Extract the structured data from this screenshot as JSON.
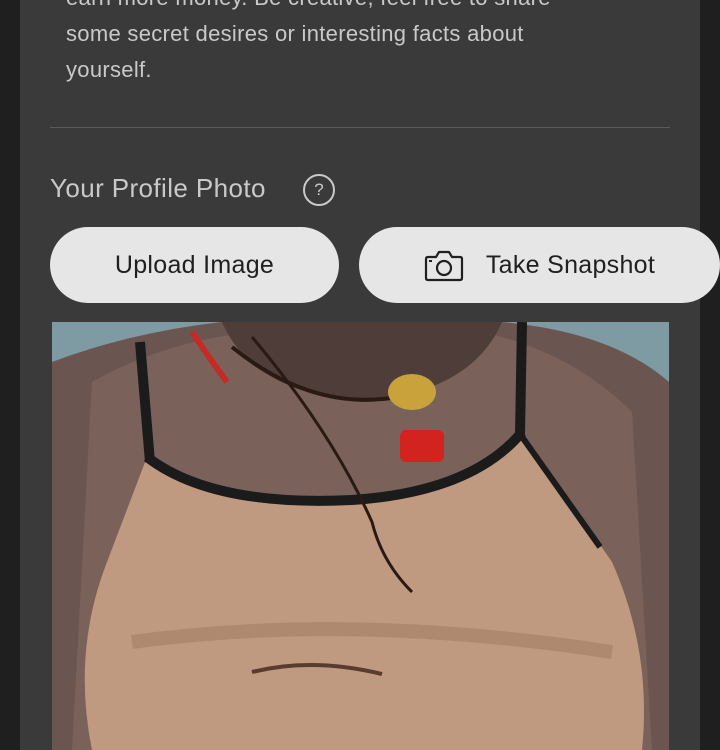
{
  "profile_description": {
    "text_cut_top": "earn more money. Be creative, feel free to share",
    "line_1": "some secret desires or interesting facts about",
    "line_2": "yourself."
  },
  "profile_photo_section": {
    "title": "Your Profile Photo",
    "help_glyph": "?",
    "upload_button_label": "Upload Image",
    "snapshot_button_label": "Take Snapshot",
    "snapshot_icon": "camera-icon"
  },
  "colors": {
    "page_bg": "#1f1f1f",
    "card_bg": "#3a3a3a",
    "text_muted": "#c9c9c9",
    "button_bg": "#e6e6e6",
    "button_text": "#202020"
  }
}
